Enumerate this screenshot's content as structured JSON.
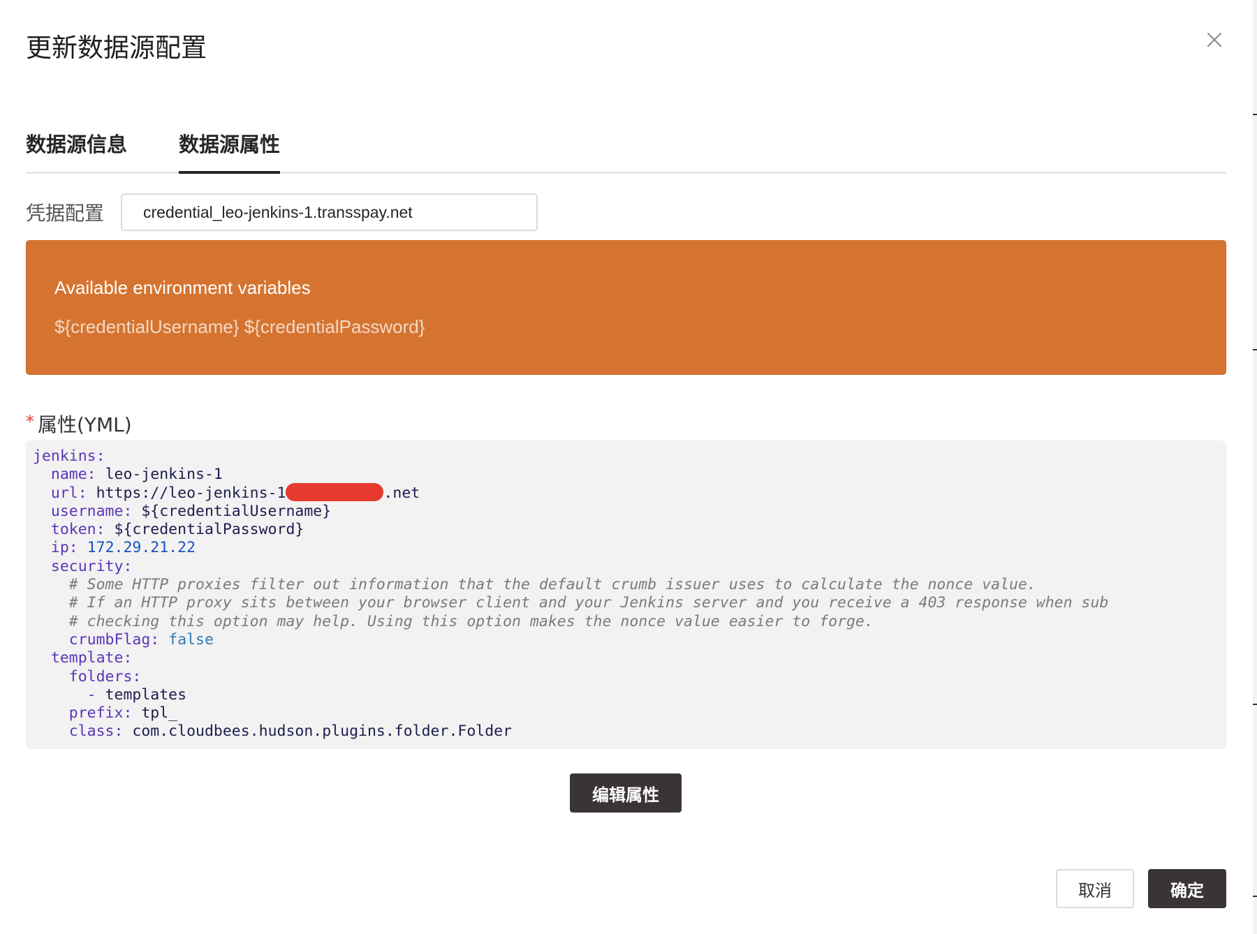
{
  "dialog": {
    "title": "更新数据源配置",
    "close_icon": "close-icon"
  },
  "tabs": [
    {
      "label": "数据源信息",
      "active": false
    },
    {
      "label": "数据源属性",
      "active": true
    }
  ],
  "credential": {
    "label": "凭据配置",
    "value": "credential_leo-jenkins-1.transspay.net"
  },
  "alert": {
    "title": "Available environment variables",
    "description": "${credentialUsername} ${credentialPassword}",
    "color": "#d57430"
  },
  "properties": {
    "required_mark": "*",
    "label": "属性(YML)",
    "code": {
      "l1_key": "jenkins:",
      "l2_key": "name:",
      "l2_val": "leo-jenkins-1",
      "l3_key": "url:",
      "l3_val_a": "https://leo-jenkins-1",
      "l3_val_b": ".net",
      "l4_key": "username:",
      "l4_val": "${credentialUsername}",
      "l5_key": "token:",
      "l5_val": "${credentialPassword}",
      "l6_key": "ip:",
      "l6_val": "172.29.21.22",
      "l7_key": "security:",
      "l8_comment": "# Some HTTP proxies filter out information that the default crumb issuer uses to calculate the nonce value.",
      "l9_comment": "# If an HTTP proxy sits between your browser client and your Jenkins server and you receive a 403 response when sub",
      "l10_comment": "# checking this option may help. Using this option makes the nonce value easier to forge.",
      "l11_key": "crumbFlag:",
      "l11_val": "false",
      "l12_key": "template:",
      "l13_key": "folders:",
      "l14_dash": "-",
      "l14_val": "templates",
      "l15_key": "prefix:",
      "l15_val": "tpl_",
      "l16_key": "class:",
      "l16_val": "com.cloudbees.hudson.plugins.folder.Folder"
    }
  },
  "buttons": {
    "edit": "编辑属性",
    "cancel": "取消",
    "ok": "确定"
  },
  "colors": {
    "primary_button": "#3a3534",
    "required": "#e33b2e"
  }
}
